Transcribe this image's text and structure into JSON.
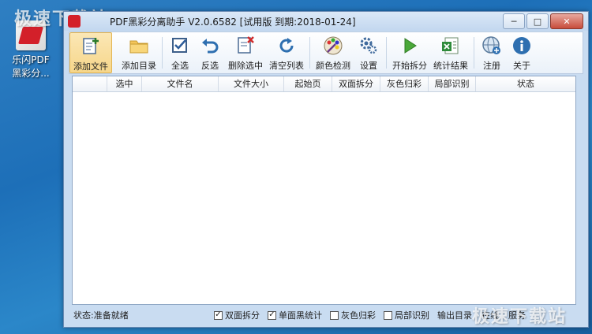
{
  "desktop": {
    "icon_label_line1": "乐闪PDF",
    "icon_label_line2": "黑彩分..."
  },
  "watermarks": {
    "top_left": "极速下载站",
    "bottom_right": "极速下载站"
  },
  "window": {
    "title": "PDF黑彩分离助手 V2.0.6582 [试用版 到期:2018-01-24]",
    "buttons": {
      "minimize": "─",
      "maximize": "□",
      "close": "✕"
    }
  },
  "toolbar": {
    "items": [
      {
        "label": "添加文件",
        "icon": "add-file-icon"
      },
      {
        "label": "添加目录",
        "icon": "folder-icon"
      },
      {
        "label": "全选",
        "icon": "check-all-icon"
      },
      {
        "label": "反选",
        "icon": "undo-icon"
      },
      {
        "label": "删除选中",
        "icon": "delete-file-icon"
      },
      {
        "label": "清空列表",
        "icon": "refresh-icon"
      },
      {
        "label": "颜色检测",
        "icon": "palette-icon"
      },
      {
        "label": "设置",
        "icon": "gear-icon"
      },
      {
        "label": "开始拆分",
        "icon": "play-icon"
      },
      {
        "label": "统计结果",
        "icon": "excel-icon"
      },
      {
        "label": "注册",
        "icon": "globe-icon"
      },
      {
        "label": "关于",
        "icon": "info-icon"
      }
    ]
  },
  "table": {
    "columns": [
      "",
      "选中",
      "文件名",
      "文件大小",
      "起始页",
      "双面拆分",
      "灰色归彩",
      "局部识别",
      "状态"
    ]
  },
  "statusbar": {
    "status": "状态:准备就绪",
    "checks": [
      {
        "label": "双面拆分",
        "checked": "✓"
      },
      {
        "label": "单面黑统计",
        "checked": "✓"
      },
      {
        "label": "灰色归彩",
        "checked": ""
      },
      {
        "label": "局部识别",
        "checked": ""
      }
    ],
    "output_dir": "输出目录",
    "extra1": "在线",
    "extra2": "服务"
  },
  "colors": {
    "accent": "#d3202a",
    "window_bg": "#c9dcf1",
    "desktop": "#1d6fb8"
  }
}
